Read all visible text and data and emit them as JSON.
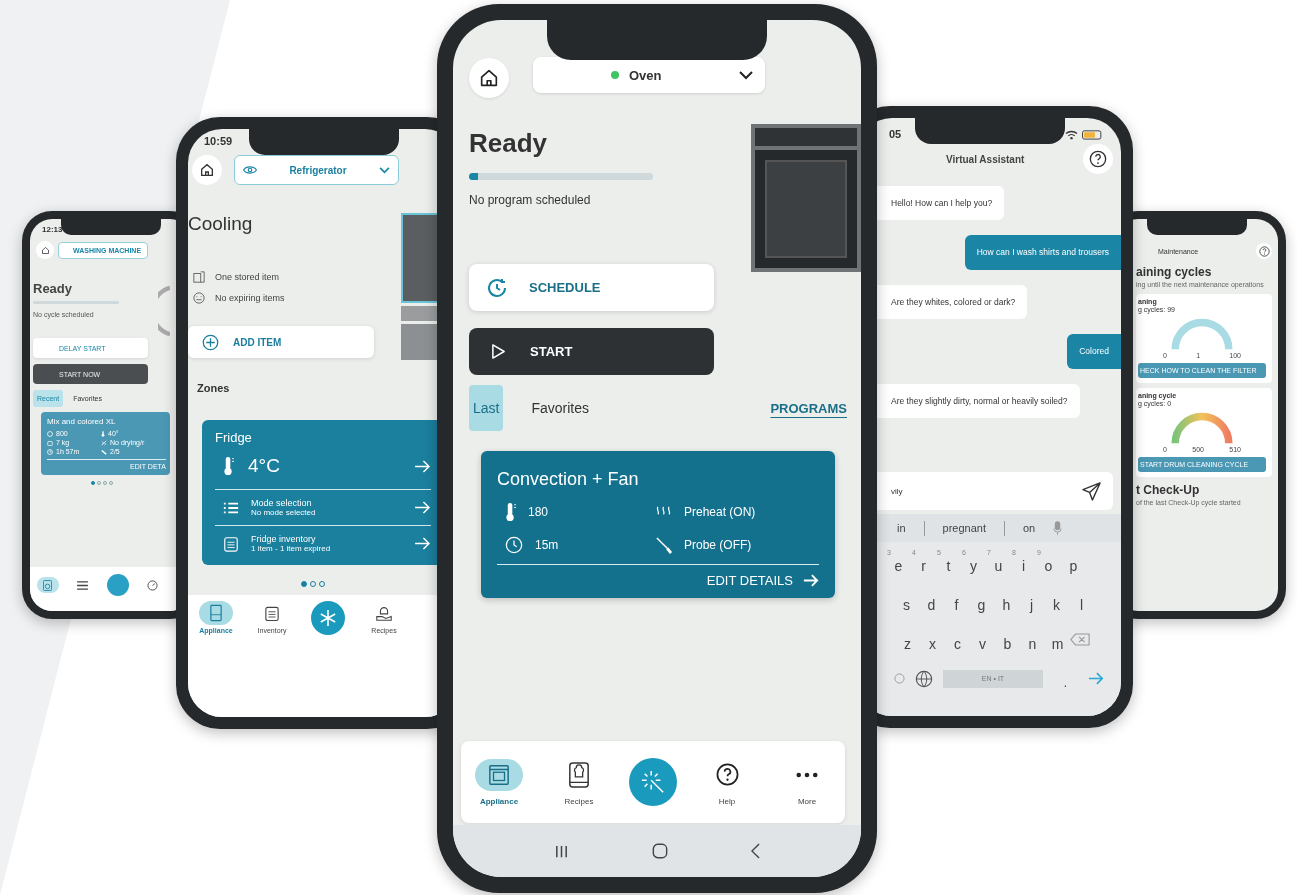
{
  "washer_phone": {
    "time": "12:13",
    "appliance": "WASHING MACHINE",
    "status": "Ready",
    "note": "No cycle scheduled",
    "delay_button": "DELAY START",
    "start_button": "START NOW",
    "tabs": [
      {
        "label": "Recent",
        "selected": true
      },
      {
        "label": "Favorites",
        "selected": false
      }
    ],
    "program": {
      "title": "Mix and colored XL",
      "specs": [
        {
          "kind": "spin",
          "text": "800"
        },
        {
          "kind": "temperature",
          "text": "40°"
        },
        {
          "kind": "weight",
          "text": "7 kg"
        },
        {
          "kind": "drying",
          "text": "No drying/r"
        },
        {
          "kind": "time",
          "text": "1h 57m"
        },
        {
          "kind": "soil",
          "text": "2/5"
        }
      ],
      "action": "EDIT DETA"
    },
    "pager": [
      {
        "selected": true
      },
      {
        "selected": false
      },
      {
        "selected": false
      },
      {
        "selected": false
      }
    ],
    "nav": [
      {
        "kind": "appliance",
        "selected": true
      },
      {
        "kind": "list",
        "selected": false
      },
      {
        "kind": "gauge",
        "selected": false
      }
    ]
  },
  "fridge_phone": {
    "time": "10:59",
    "appliance": "Refrigerator",
    "status": "Cooling",
    "info": [
      {
        "kind": "stored",
        "text": "One stored item"
      },
      {
        "kind": "expiring",
        "text": "No expiring items"
      }
    ],
    "add_button": "ADD ITEM",
    "section": "Zones",
    "zone_card": {
      "title": "Fridge",
      "temperature": "4°C",
      "rows": [
        {
          "kind": "list",
          "title": "Mode selection",
          "subtitle": "No mode selected"
        },
        {
          "kind": "clipboard",
          "title": "Fridge inventory",
          "subtitle": "1 item - 1 item expired"
        }
      ]
    },
    "pager": [
      {
        "selected": true
      },
      {
        "selected": false
      },
      {
        "selected": false
      }
    ],
    "nav": [
      {
        "kind": "appliance",
        "label": "Appliance",
        "selected": true
      },
      {
        "kind": "clipboard",
        "label": "Inventory",
        "selected": false
      },
      {
        "kind": "recipes",
        "label": "Recipes",
        "selected": false
      }
    ]
  },
  "oven_phone": {
    "appliance": "Oven",
    "status": "Ready",
    "progress": {
      "level": 0.05
    },
    "note": "No program scheduled",
    "schedule_button": "SCHEDULE",
    "start_button": "START",
    "tabs": [
      {
        "label": "Last",
        "selected": true
      },
      {
        "label": "Favorites",
        "selected": false
      }
    ],
    "programs_link": "PROGRAMS",
    "program": {
      "title": "Convection + Fan",
      "specs": [
        {
          "kind": "temperature",
          "text": "180"
        },
        {
          "kind": "preheat",
          "text": "Preheat (ON)"
        },
        {
          "kind": "time",
          "text": "15m"
        },
        {
          "kind": "probe",
          "text": "Probe (OFF)"
        }
      ],
      "action": "EDIT DETAILS"
    },
    "nav": [
      {
        "kind": "appliance",
        "label": "Appliance",
        "selected": true
      },
      {
        "kind": "recipes",
        "label": "Recipes",
        "selected": false
      },
      {
        "kind": "help",
        "label": "Help",
        "selected": false
      },
      {
        "kind": "more",
        "label": "More",
        "selected": false
      }
    ]
  },
  "assistant_phone": {
    "time": "05",
    "title": "Virtual Assistant",
    "messages": [
      {
        "kind": "bot",
        "text": "Hello! How can I help you?"
      },
      {
        "kind": "user",
        "text": "How can I wash shirts and trousers"
      },
      {
        "kind": "bot",
        "text": "Are they whites, colored or dark?"
      },
      {
        "kind": "user",
        "text": "Colored"
      },
      {
        "kind": "bot",
        "text": "Are they slightly dirty, normal or heavily soiled?"
      }
    ],
    "input": {
      "value": "vily"
    },
    "suggestions": [
      "in",
      "pregnant",
      "on"
    ],
    "keyboard": [
      [
        {
          "key": "e",
          "hint": "3"
        },
        {
          "key": "r",
          "hint": "4"
        },
        {
          "key": "t",
          "hint": "5"
        },
        {
          "key": "y",
          "hint": "6"
        },
        {
          "key": "u",
          "hint": "7"
        },
        {
          "key": "i",
          "hint": "8"
        },
        {
          "key": "o",
          "hint": "9"
        },
        {
          "key": "p"
        }
      ],
      [
        {
          "key": "s"
        },
        {
          "key": "d"
        },
        {
          "key": "f"
        },
        {
          "key": "g"
        },
        {
          "key": "h"
        },
        {
          "key": "j"
        },
        {
          "key": "k"
        },
        {
          "key": "l"
        }
      ],
      [
        {
          "key": "z"
        },
        {
          "key": "x"
        },
        {
          "key": "c"
        },
        {
          "key": "v"
        },
        {
          "key": "b"
        },
        {
          "key": "n"
        },
        {
          "key": "m"
        }
      ]
    ],
    "space_key": "EN • IT",
    "period_key": "."
  },
  "maintenance_phone": {
    "title": "Maintenance",
    "heading": "aining cycles",
    "subheading": "ing until the next maintenance operations",
    "cards": [
      {
        "title": "aning",
        "subtitle": "g cycles: 99",
        "gauge": {
          "kind": "plain",
          "labels": [
            "0",
            "1",
            "100"
          ]
        },
        "button": "HECK HOW TO CLEAN THE FILTER"
      },
      {
        "title": "aning cycle",
        "subtitle": "g cycles: 0",
        "gauge": {
          "kind": "gradient",
          "labels": [
            "0",
            "500",
            "510"
          ]
        },
        "button": "START DRUM CLEANING CYCLE"
      }
    ],
    "checkup_heading": "t Check-Up",
    "checkup_note": "of the last Check-Up cycle started"
  }
}
